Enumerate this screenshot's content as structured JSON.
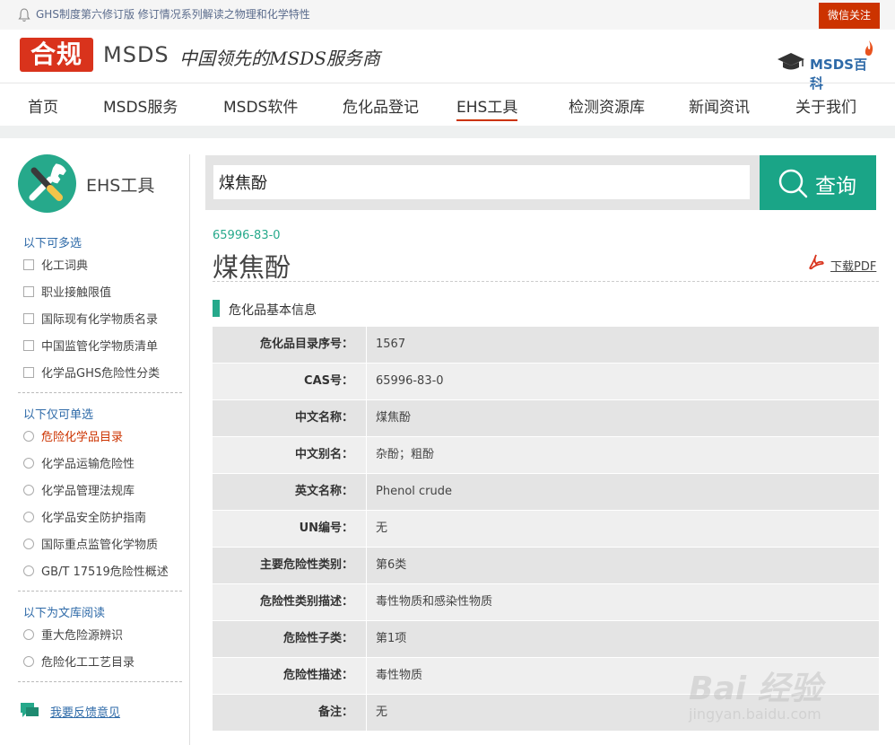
{
  "topbar": {
    "notice": "GHS制度第六修订版 修订情况系列解读之物理和化学特性",
    "wechat": "微信关注"
  },
  "header": {
    "logo": "合规",
    "logo_msds": "MSDS",
    "slogan": "中国领先的MSDS服务商",
    "baike": "MSDS百科"
  },
  "nav": {
    "items": [
      "首页",
      "MSDS服务",
      "MSDS软件",
      "危化品登记",
      "EHS工具",
      "检测资源库",
      "新闻资讯",
      "关于我们"
    ],
    "active": "EHS工具"
  },
  "sidebar": {
    "title": "EHS工具",
    "multi_title": "以下可多选",
    "multi": [
      "化工词典",
      "职业接触限值",
      "国际现有化学物质名录",
      "中国监管化学物质清单",
      "化学品GHS危险性分类"
    ],
    "single_title": "以下仅可单选",
    "single": [
      "危险化学品目录",
      "化学品运输危险性",
      "化学品管理法规库",
      "化学品安全防护指南",
      "国际重点监管化学物质",
      "GB/T 17519危险性概述"
    ],
    "single_selected": "危险化学品目录",
    "library_title": "以下为文库阅读",
    "library": [
      "重大危险源辨识",
      "危险化工工艺目录"
    ],
    "feedback": "我要反馈意见"
  },
  "search": {
    "value": "煤焦酚",
    "button": "查询"
  },
  "detail": {
    "cas": "65996-83-0",
    "name": "煤焦酚",
    "pdf": "下载PDF",
    "section": "危化品基本信息",
    "rows": [
      {
        "key": "危化品目录序号：",
        "value": "1567"
      },
      {
        "key": "CAS号：",
        "value": "65996-83-0"
      },
      {
        "key": "中文名称：",
        "value": "煤焦酚"
      },
      {
        "key": "中文别名：",
        "value": "杂酚；粗酚"
      },
      {
        "key": "英文名称：",
        "value": "Phenol crude"
      },
      {
        "key": "UN编号：",
        "value": "无"
      },
      {
        "key": "主要危险性类别：",
        "value": "第6类"
      },
      {
        "key": "危险性类别描述：",
        "value": "毒性物质和感染性物质"
      },
      {
        "key": "危险性子类：",
        "value": "第1项"
      },
      {
        "key": "危险性描述：",
        "value": "毒性物质"
      },
      {
        "key": "备注：",
        "value": "无"
      }
    ]
  },
  "watermark": {
    "big": "Bai 经验",
    "small": "jingyan.baidu.com"
  }
}
